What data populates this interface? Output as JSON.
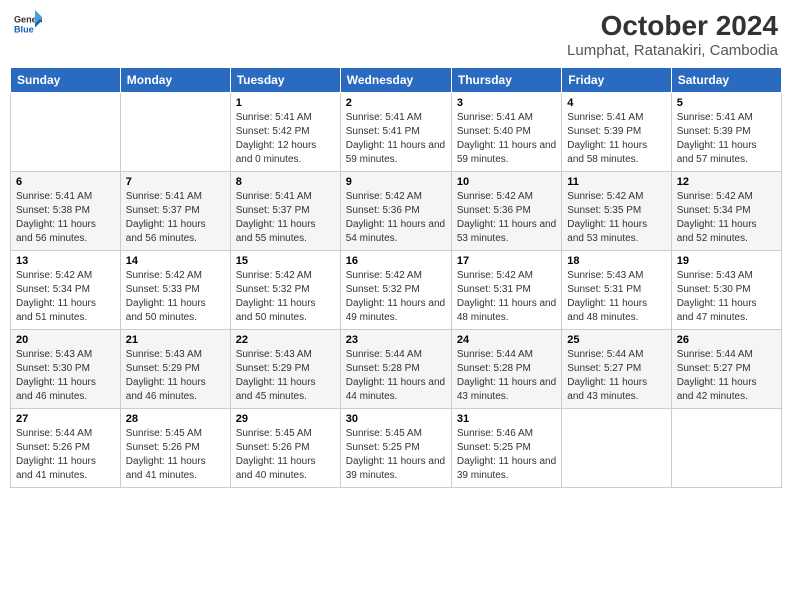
{
  "header": {
    "logo_line1": "General",
    "logo_line2": "Blue",
    "title": "October 2024",
    "subtitle": "Lumphat, Ratanakiri, Cambodia"
  },
  "columns": [
    "Sunday",
    "Monday",
    "Tuesday",
    "Wednesday",
    "Thursday",
    "Friday",
    "Saturday"
  ],
  "weeks": [
    [
      {
        "day": "",
        "info": ""
      },
      {
        "day": "",
        "info": ""
      },
      {
        "day": "1",
        "info": "Sunrise: 5:41 AM\nSunset: 5:42 PM\nDaylight: 12 hours and 0 minutes."
      },
      {
        "day": "2",
        "info": "Sunrise: 5:41 AM\nSunset: 5:41 PM\nDaylight: 11 hours and 59 minutes."
      },
      {
        "day": "3",
        "info": "Sunrise: 5:41 AM\nSunset: 5:40 PM\nDaylight: 11 hours and 59 minutes."
      },
      {
        "day": "4",
        "info": "Sunrise: 5:41 AM\nSunset: 5:39 PM\nDaylight: 11 hours and 58 minutes."
      },
      {
        "day": "5",
        "info": "Sunrise: 5:41 AM\nSunset: 5:39 PM\nDaylight: 11 hours and 57 minutes."
      }
    ],
    [
      {
        "day": "6",
        "info": "Sunrise: 5:41 AM\nSunset: 5:38 PM\nDaylight: 11 hours and 56 minutes."
      },
      {
        "day": "7",
        "info": "Sunrise: 5:41 AM\nSunset: 5:37 PM\nDaylight: 11 hours and 56 minutes."
      },
      {
        "day": "8",
        "info": "Sunrise: 5:41 AM\nSunset: 5:37 PM\nDaylight: 11 hours and 55 minutes."
      },
      {
        "day": "9",
        "info": "Sunrise: 5:42 AM\nSunset: 5:36 PM\nDaylight: 11 hours and 54 minutes."
      },
      {
        "day": "10",
        "info": "Sunrise: 5:42 AM\nSunset: 5:36 PM\nDaylight: 11 hours and 53 minutes."
      },
      {
        "day": "11",
        "info": "Sunrise: 5:42 AM\nSunset: 5:35 PM\nDaylight: 11 hours and 53 minutes."
      },
      {
        "day": "12",
        "info": "Sunrise: 5:42 AM\nSunset: 5:34 PM\nDaylight: 11 hours and 52 minutes."
      }
    ],
    [
      {
        "day": "13",
        "info": "Sunrise: 5:42 AM\nSunset: 5:34 PM\nDaylight: 11 hours and 51 minutes."
      },
      {
        "day": "14",
        "info": "Sunrise: 5:42 AM\nSunset: 5:33 PM\nDaylight: 11 hours and 50 minutes."
      },
      {
        "day": "15",
        "info": "Sunrise: 5:42 AM\nSunset: 5:32 PM\nDaylight: 11 hours and 50 minutes."
      },
      {
        "day": "16",
        "info": "Sunrise: 5:42 AM\nSunset: 5:32 PM\nDaylight: 11 hours and 49 minutes."
      },
      {
        "day": "17",
        "info": "Sunrise: 5:42 AM\nSunset: 5:31 PM\nDaylight: 11 hours and 48 minutes."
      },
      {
        "day": "18",
        "info": "Sunrise: 5:43 AM\nSunset: 5:31 PM\nDaylight: 11 hours and 48 minutes."
      },
      {
        "day": "19",
        "info": "Sunrise: 5:43 AM\nSunset: 5:30 PM\nDaylight: 11 hours and 47 minutes."
      }
    ],
    [
      {
        "day": "20",
        "info": "Sunrise: 5:43 AM\nSunset: 5:30 PM\nDaylight: 11 hours and 46 minutes."
      },
      {
        "day": "21",
        "info": "Sunrise: 5:43 AM\nSunset: 5:29 PM\nDaylight: 11 hours and 46 minutes."
      },
      {
        "day": "22",
        "info": "Sunrise: 5:43 AM\nSunset: 5:29 PM\nDaylight: 11 hours and 45 minutes."
      },
      {
        "day": "23",
        "info": "Sunrise: 5:44 AM\nSunset: 5:28 PM\nDaylight: 11 hours and 44 minutes."
      },
      {
        "day": "24",
        "info": "Sunrise: 5:44 AM\nSunset: 5:28 PM\nDaylight: 11 hours and 43 minutes."
      },
      {
        "day": "25",
        "info": "Sunrise: 5:44 AM\nSunset: 5:27 PM\nDaylight: 11 hours and 43 minutes."
      },
      {
        "day": "26",
        "info": "Sunrise: 5:44 AM\nSunset: 5:27 PM\nDaylight: 11 hours and 42 minutes."
      }
    ],
    [
      {
        "day": "27",
        "info": "Sunrise: 5:44 AM\nSunset: 5:26 PM\nDaylight: 11 hours and 41 minutes."
      },
      {
        "day": "28",
        "info": "Sunrise: 5:45 AM\nSunset: 5:26 PM\nDaylight: 11 hours and 41 minutes."
      },
      {
        "day": "29",
        "info": "Sunrise: 5:45 AM\nSunset: 5:26 PM\nDaylight: 11 hours and 40 minutes."
      },
      {
        "day": "30",
        "info": "Sunrise: 5:45 AM\nSunset: 5:25 PM\nDaylight: 11 hours and 39 minutes."
      },
      {
        "day": "31",
        "info": "Sunrise: 5:46 AM\nSunset: 5:25 PM\nDaylight: 11 hours and 39 minutes."
      },
      {
        "day": "",
        "info": ""
      },
      {
        "day": "",
        "info": ""
      }
    ]
  ]
}
